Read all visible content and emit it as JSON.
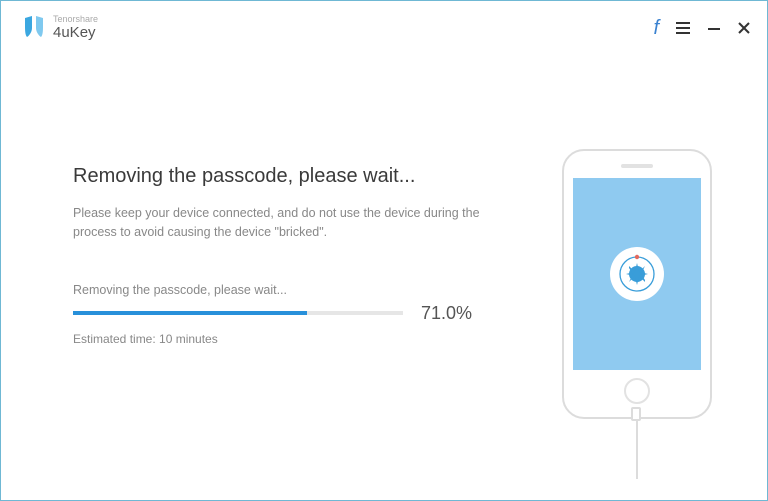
{
  "brand": {
    "company": "Tenorshare",
    "product": "4uKey"
  },
  "main": {
    "heading": "Removing the passcode, please wait...",
    "instruction": "Please keep your device connected, and do not use the device during the process to avoid causing the device \"bricked\"."
  },
  "progress": {
    "label": "Removing the passcode, please wait...",
    "percent_text": "71.0%",
    "percent_value": 71.0,
    "estimated": "Estimated time: 10 minutes"
  }
}
